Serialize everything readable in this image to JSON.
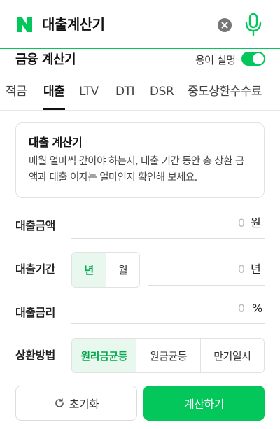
{
  "search": {
    "query": "대출계산기"
  },
  "header": {
    "title": "금융 계산기",
    "toggle_label": "용어 설명",
    "toggle_on": true
  },
  "tabs": [
    "적금",
    "대출",
    "LTV",
    "DTI",
    "DSR",
    "중도상환수수료"
  ],
  "active_tab": "대출",
  "info": {
    "title": "대출 계산기",
    "description": "매월 얼마씩 갚아야 하는지, 대출 기간 동안 총 상환 금액과 대출 이자는 얼마인지 확인해 보세요."
  },
  "form": {
    "amount": {
      "label": "대출금액",
      "value": "0",
      "unit": "원"
    },
    "period": {
      "label": "대출기간",
      "value": "0",
      "unit": "년",
      "options": [
        "년",
        "월"
      ],
      "selected": "년"
    },
    "rate": {
      "label": "대출금리",
      "value": "0",
      "unit": "%"
    },
    "method": {
      "label": "상환방법",
      "options": [
        "원리금균등",
        "원금균등",
        "만기일시"
      ],
      "selected": "원리금균등"
    }
  },
  "buttons": {
    "reset": "초기화",
    "calculate": "계산하기"
  },
  "colors": {
    "brand": "#03c75a",
    "active_segment_bg": "#e9f8ef"
  }
}
